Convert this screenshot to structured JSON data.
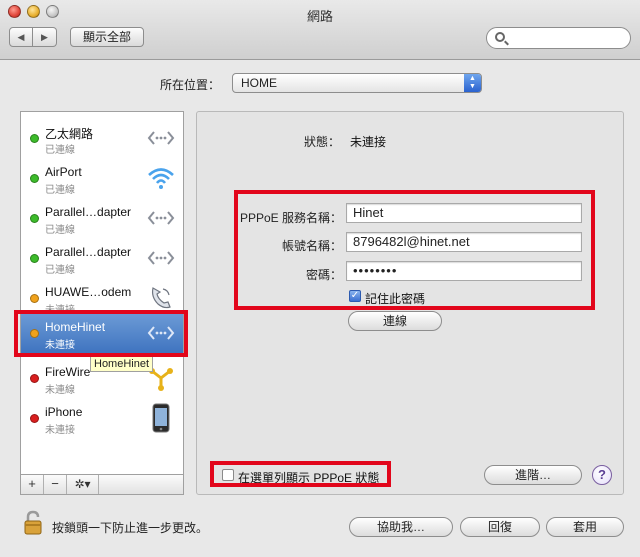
{
  "window": {
    "title": "網路"
  },
  "toolbar": {
    "back": "◀",
    "forward": "▶",
    "show_all": "顯示全部",
    "search_placeholder": ""
  },
  "location": {
    "label": "所在位置：",
    "value": "HOME"
  },
  "services": [
    {
      "name": "乙太網路",
      "status": "已連線",
      "dot_color": "#3dbb2b",
      "icon": "ethernet-icon"
    },
    {
      "name": "AirPort",
      "status": "已連線",
      "dot_color": "#3dbb2b",
      "icon": "wifi-icon"
    },
    {
      "name": "Parallel…dapter",
      "status": "已連線",
      "dot_color": "#3dbb2b",
      "icon": "ethernet-icon"
    },
    {
      "name": "Parallel…dapter",
      "status": "已連線",
      "dot_color": "#3dbb2b",
      "icon": "ethernet-icon"
    },
    {
      "name": "HUAWE…odem",
      "status": "未連接",
      "dot_color": "#f0a21c",
      "icon": "phone-modem-icon"
    },
    {
      "name": "HomeHinet",
      "status": "未連接",
      "dot_color": "#f0a21c",
      "icon": "ethernet-icon",
      "selected": true
    },
    {
      "name": "FireWire",
      "status": "未連線",
      "dot_color": "#d91f1f",
      "icon": "firewire-icon"
    },
    {
      "name": "iPhone",
      "status": "未連接",
      "dot_color": "#d91f1f",
      "icon": "iphone-icon"
    }
  ],
  "tooltip": "HomeHinet",
  "sidebar_controls": {
    "add": "+",
    "remove": "−",
    "gear": "✲▾"
  },
  "detail": {
    "status_label": "狀態：",
    "status_value": "未連接",
    "service_name_label": "PPPoE 服務名稱：",
    "service_name_value": "Hinet",
    "account_label": "帳號名稱：",
    "account_value": "8796482l@hinet.net",
    "password_label": "密碼：",
    "password_value": "••••••••",
    "remember_label": "記住此密碼",
    "remember_checked": true,
    "connect_button": "連線",
    "menubar_checkbox_label": "在選單列顯示 PPPoE 狀態",
    "menubar_checked": false,
    "advanced_button": "進階…",
    "help_button": "?"
  },
  "footer": {
    "lock_text": "按鎖頭一下防止進一步更改。",
    "assist_button": "協助我…",
    "revert_button": "回復",
    "apply_button": "套用"
  },
  "colors": {
    "highlight_red": "#e2061b",
    "selection_blue": "#3f74c0"
  }
}
